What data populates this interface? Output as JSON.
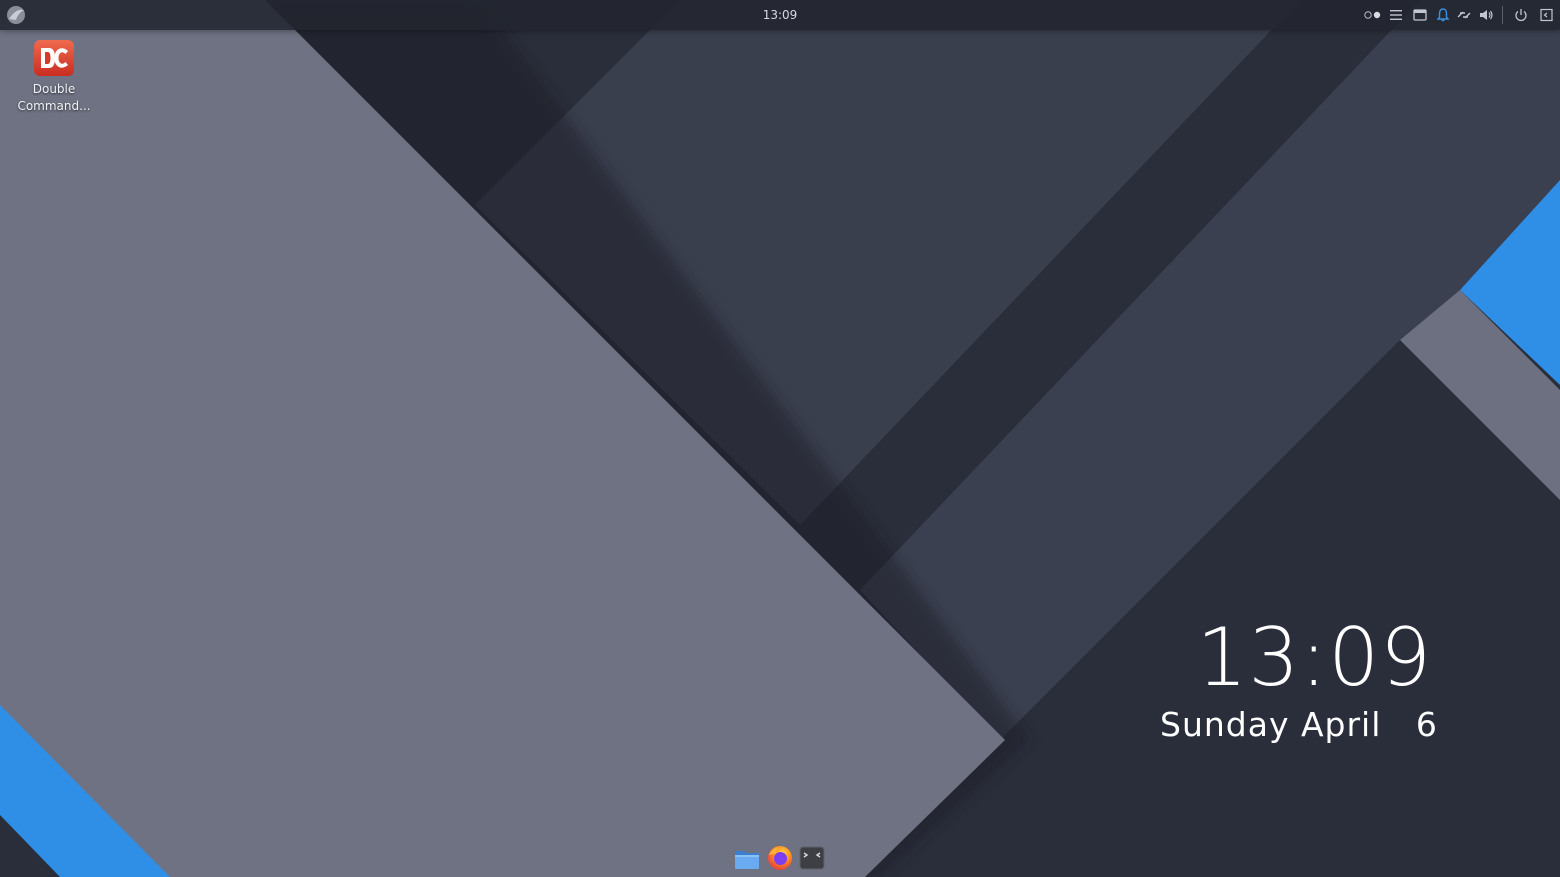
{
  "panel": {
    "clock": "13:09",
    "launcher_icon": "plasma-launcher-icon",
    "tray_icons": [
      "pager-icon",
      "menu-icon",
      "window-list-icon",
      "notifications-icon",
      "network-icon",
      "volume-icon",
      "power-icon",
      "show-desktop-icon"
    ]
  },
  "desktop_icons": [
    {
      "label": "Double\nCommand...",
      "icon": "double-commander-icon"
    }
  ],
  "clock_widget": {
    "time": "13:09",
    "date": "Sunday April   6"
  },
  "dock": {
    "items": [
      "file-manager-icon",
      "firefox-icon",
      "terminal-icon"
    ]
  },
  "colors": {
    "panel_bg": "#22252f",
    "wallpaper_dark": "#2b2f3c",
    "wallpaper_mid": "#3b4050",
    "wallpaper_light": "#6c7080",
    "accent_blue": "#2f8fe6",
    "notification_blue": "#3d8fe0"
  }
}
